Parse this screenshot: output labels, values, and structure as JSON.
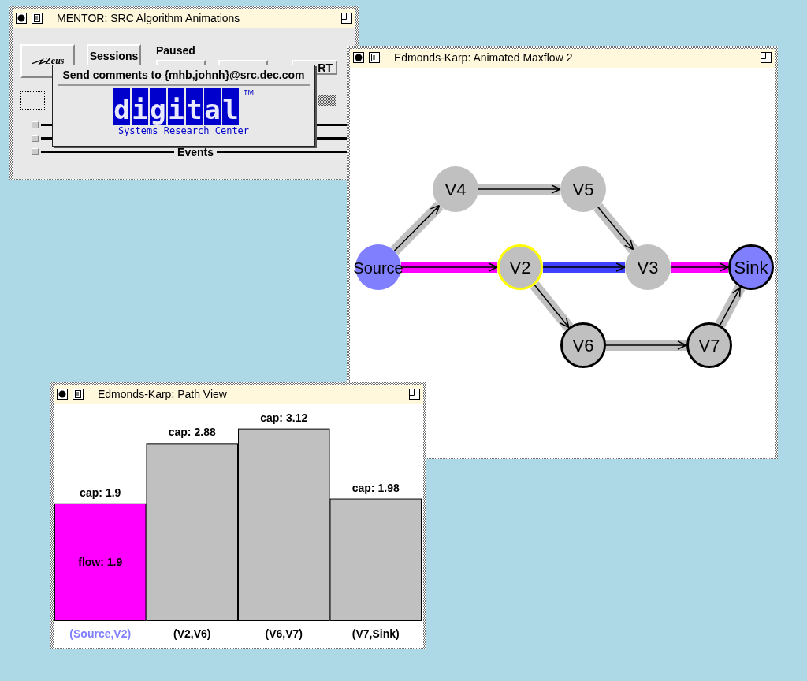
{
  "mentor": {
    "title": "MENTOR: SRC Algorithm Animations",
    "logo_button": "Zeus",
    "sessions_button": "Sessions",
    "status": "Paused",
    "control_button": "RT",
    "option_checked": false,
    "tracks": [
      {
        "kind": "plain",
        "checked": false
      },
      {
        "kind": "plain",
        "checked": false
      },
      {
        "kind": "labeled",
        "label": "Events",
        "checked": false
      }
    ]
  },
  "popup": {
    "message": "Send comments to {mhb,johnh}@src.dec.com",
    "logo_letters": [
      "d",
      "i",
      "g",
      "i",
      "t",
      "a",
      "l"
    ],
    "trademark": "TM",
    "caption": "Systems Research Center"
  },
  "graph_window": {
    "title": "Edmonds-Karp: Animated Maxflow 2",
    "nodes": [
      {
        "label": "Source",
        "color": "#8080ff",
        "current": false,
        "finished": false
      },
      {
        "label": "V2",
        "color": "#c0c0c0",
        "current": true,
        "finished": false
      },
      {
        "label": "V3",
        "color": "#c0c0c0",
        "current": false,
        "finished": false
      },
      {
        "label": "Sink",
        "color": "#8080ff",
        "current": false,
        "finished": true
      },
      {
        "label": "V4",
        "color": "#c0c0c0",
        "current": false,
        "finished": false
      },
      {
        "label": "V5",
        "color": "#c0c0c0",
        "current": false,
        "finished": false
      },
      {
        "label": "V6",
        "color": "#c0c0c0",
        "current": false,
        "finished": true
      },
      {
        "label": "V7",
        "color": "#c0c0c0",
        "current": false,
        "finished": true
      }
    ],
    "edges": [
      {
        "color": "#c0c0c0"
      },
      {
        "color": "#c0c0c0"
      },
      {
        "color": "#c0c0c0"
      },
      {
        "color": "#ff00ff"
      },
      {
        "color": "#4040ff"
      },
      {
        "color": "#ff00ff"
      },
      {
        "color": "#c0c0c0"
      },
      {
        "color": "#c0c0c0"
      },
      {
        "color": "#c0c0c0"
      }
    ]
  },
  "path_view": {
    "title": "Edmonds-Karp: Path View",
    "bar_states": [
      {
        "color": "#ff00ff",
        "highlighted": true,
        "annotation": "flow: 1.9"
      },
      {
        "color": "#c0c0c0",
        "highlighted": false
      },
      {
        "color": "#c0c0c0",
        "highlighted": false
      },
      {
        "color": "#c0c0c0",
        "highlighted": false
      }
    ],
    "chart_data": {
      "type": "bar",
      "categories": [
        "(Source,V2)",
        "(V2,V6)",
        "(V6,V7)",
        "(V7,Sink)"
      ],
      "series": [
        {
          "name": "cap:",
          "values": [
            1.9,
            2.88,
            3.12,
            1.98
          ]
        }
      ],
      "data_labels": true
    }
  }
}
